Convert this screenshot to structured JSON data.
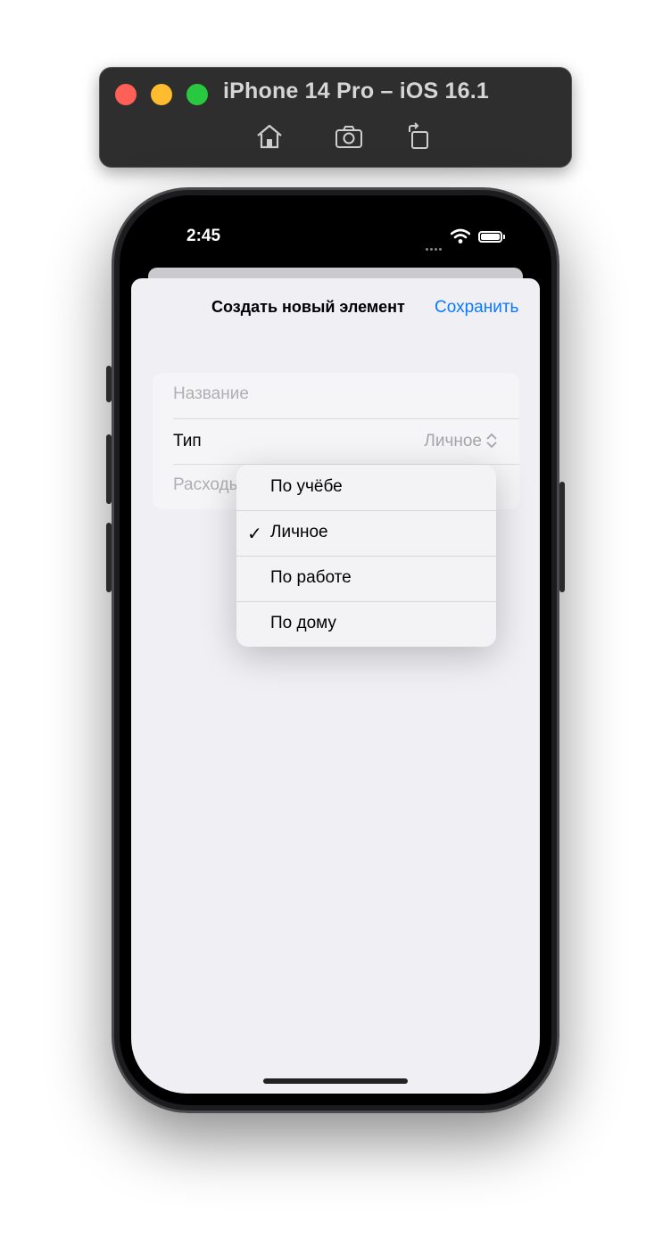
{
  "simulator": {
    "title": "iPhone 14 Pro – iOS 16.1",
    "icons": [
      "home-icon",
      "screenshot-icon",
      "rotate-icon"
    ]
  },
  "status_bar": {
    "time": "2:45"
  },
  "nav": {
    "title": "Создать новый элемент",
    "save_label": "Сохранить"
  },
  "form": {
    "name_placeholder": "Название",
    "type_label": "Тип",
    "type_value": "Личное",
    "expenses_placeholder": "Расходы"
  },
  "menu": {
    "items": [
      {
        "label": "По учёбе",
        "checked": false
      },
      {
        "label": "Личное",
        "checked": true
      },
      {
        "label": "По работе",
        "checked": false
      },
      {
        "label": "По дому",
        "checked": false
      }
    ],
    "check_glyph": "✓"
  },
  "colors": {
    "accent": "#0a7aff",
    "sheet_background": "#efeff4"
  }
}
